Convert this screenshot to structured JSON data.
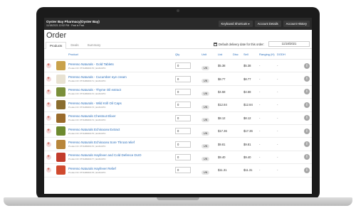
{
  "header": {
    "store_name": "Oyster Bay Pharmacy(Oyster Bay)",
    "store_meta": "11/18/2021 12:52 PM · Past is Past",
    "nav": [
      "Keyboard Shortcuts ▾",
      "Account Details",
      "Account History"
    ]
  },
  "page": {
    "title": "Order",
    "tabs": [
      "Products",
      "Deals",
      "Summary"
    ],
    "delivery_label": "Default delivery date for this order:",
    "delivery_date": "11/18/2021"
  },
  "columns": {
    "product": "Product",
    "qty": "Qty",
    "unit": "Unit",
    "list": "List",
    "disc": "Disc",
    "sell": "Sell",
    "ranging": "Ranging (H)",
    "dodh": "DODH"
  },
  "rows": [
    {
      "name": "Perenso Naturals - Gold Tablets",
      "pid": "Product ID: PHARM00170 | EAN/UPC:",
      "qty": "0",
      "unit": "UN",
      "list": "$5.38",
      "sell": "$5.38",
      "disc": "",
      "ranging": "-",
      "dodh": "-",
      "thumb_color": "#c9a24b"
    },
    {
      "name": "Perenso Naturals - Cucumber eye cream",
      "pid": "Product ID: PHARM00171 | EAN/UPC:",
      "qty": "0",
      "unit": "UN",
      "list": "$8.77",
      "sell": "$8.77",
      "disc": "",
      "ranging": "-",
      "dodh": "-",
      "thumb_color": "#e8e2d2"
    },
    {
      "name": "Perenso Naturals - Thyme Oil extract",
      "pid": "Product ID: PHARM00172 | EAN/UPC:",
      "qty": "0",
      "unit": "UN",
      "list": "$4.58",
      "sell": "$4.58",
      "disc": "",
      "ranging": "-",
      "dodh": "-",
      "thumb_color": "#7a8f3a"
    },
    {
      "name": "Perenso Naturals - Wild Krill Oil Caps",
      "pid": "Product ID: PHARM00173 | EAN/UPC:",
      "qty": "0",
      "unit": "UN",
      "list": "$12.84",
      "sell": "$12.84",
      "disc": "",
      "ranging": "-",
      "dodh": "-",
      "thumb_color": "#8a6d2f"
    },
    {
      "name": "Perenso Naturals Chestnut Elixer",
      "pid": "Product ID: PHARM00174 | EAN/UPC:",
      "qty": "0",
      "unit": "UN",
      "list": "$8.12",
      "sell": "$8.12",
      "disc": "",
      "ranging": "-",
      "dodh": "-",
      "thumb_color": "#9a6b2b"
    },
    {
      "name": "Perenso Naturals Echinacea Extract",
      "pid": "Product ID: PHARM00175 | EAN/UPC:",
      "qty": "0",
      "unit": "UN",
      "list": "$17.36",
      "sell": "$17.36",
      "disc": "",
      "ranging": "-",
      "dodh": "-",
      "thumb_color": "#6d8a2f"
    },
    {
      "name": "Perenso Naturals Echinacea Sore Throat relief",
      "pid": "Product ID: PHARM00176 | EAN/UPC:",
      "qty": "0",
      "unit": "UN",
      "list": "$9.81",
      "sell": "$9.81",
      "disc": "",
      "ranging": "-",
      "dodh": "-",
      "thumb_color": "#b8863b"
    },
    {
      "name": "Perenso Naturals Hayfever and Cold Defence DUO",
      "pid": "Product ID: PHARM00177 | EAN/UPC:",
      "qty": "0",
      "unit": "UN",
      "list": "$9.40",
      "sell": "$9.40",
      "disc": "",
      "ranging": "-",
      "dodh": "-",
      "thumb_color": "#c23b2b"
    },
    {
      "name": "Perenso Naturals Hayfever Relief",
      "pid": "Product ID: PHARM00178 | EAN/UPC:",
      "qty": "0",
      "unit": "UN",
      "list": "$11.31",
      "sell": "$11.31",
      "disc": "",
      "ranging": "-",
      "dodh": "-",
      "thumb_color": "#d04a2e"
    }
  ],
  "icons": {
    "add": "plus-icon",
    "info": "info-icon",
    "calendar": "calendar-icon"
  }
}
